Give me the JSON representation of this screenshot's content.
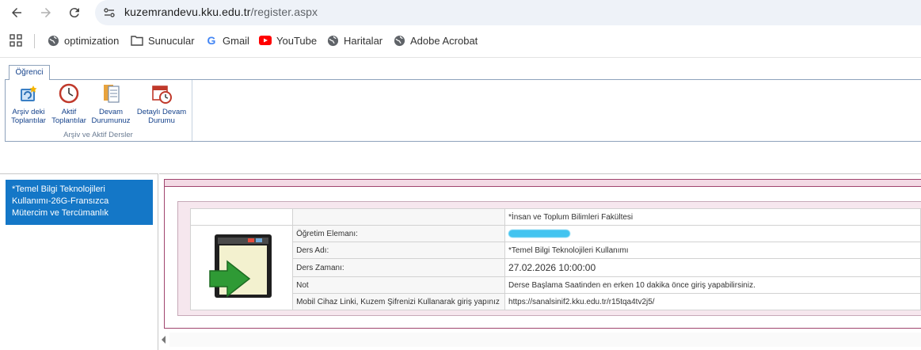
{
  "browser": {
    "url_host": "kuzemrandevu.kku.edu.tr",
    "url_path": "/register.aspx"
  },
  "bookmarks": [
    {
      "label": "optimization",
      "icon": "globe-icon"
    },
    {
      "label": "Sunucular",
      "icon": "folder-icon"
    },
    {
      "label": "Gmail",
      "icon": "google-icon"
    },
    {
      "label": "YouTube",
      "icon": "youtube-icon"
    },
    {
      "label": "Haritalar",
      "icon": "globe-icon"
    },
    {
      "label": "Adobe Acrobat",
      "icon": "globe-icon"
    }
  ],
  "ribbon": {
    "tab": "Öğrenci",
    "group_label": "Arşiv ve Aktif Dersler",
    "buttons": [
      {
        "line1": "Arşiv deki",
        "line2": "Toplantılar",
        "icon": "archive-meetings-icon"
      },
      {
        "line1": "Aktif",
        "line2": "Toplantılar",
        "icon": "clock-icon"
      },
      {
        "line1": "Devam",
        "line2": "Durumunuz",
        "icon": "attendance-icon"
      },
      {
        "line1": "Detaylı Devam",
        "line2": "Durumu",
        "icon": "calendar-clock-icon"
      }
    ]
  },
  "sidebar": {
    "course_lines": [
      "*Temel Bilgi Teknolojileri",
      "Kullanımı-26G-Fransızca",
      "Mütercim ve Tercümanlık"
    ]
  },
  "details": {
    "faculty": "*İnsan ve Toplum Bilimleri Fakültesi",
    "rows": [
      {
        "label": "Öğretim Elemanı:",
        "value": ""
      },
      {
        "label": "Ders Adı:",
        "value": "*Temel Bilgi Teknolojileri Kullanımı"
      },
      {
        "label": "Ders Zamanı:",
        "value": "27.02.2026 10:00:00"
      },
      {
        "label": "Not",
        "value": "Derse Başlama Saatinden en erken 10 dakika önce giriş yapabilirsiniz."
      },
      {
        "label": "Mobil Cihaz Linki, Kuzem Şifrenizi Kullanarak giriş yapınız",
        "value": "https://sanalsinif2.kku.edu.tr/r15tqa4tv2j5/"
      }
    ]
  }
}
